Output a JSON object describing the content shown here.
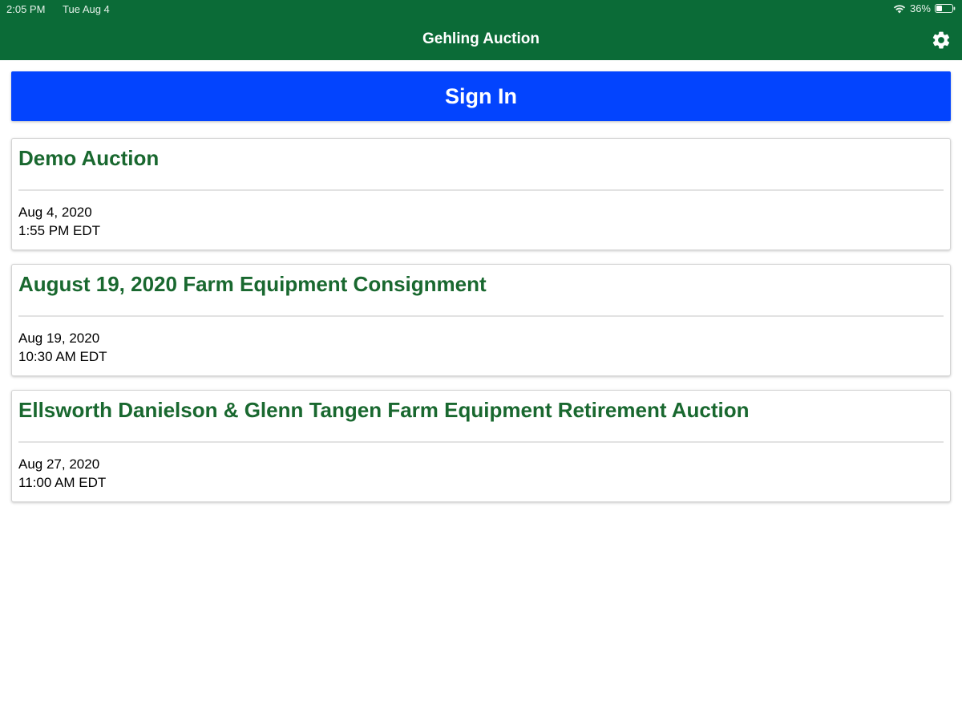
{
  "status_bar": {
    "time": "2:05 PM",
    "date": "Tue Aug 4",
    "battery": "36%"
  },
  "nav": {
    "title": "Gehling Auction",
    "settings_icon": "gear-icon"
  },
  "signin": {
    "label": "Sign In"
  },
  "auctions": [
    {
      "title": "Demo Auction",
      "date": "Aug 4, 2020",
      "time": "1:55 PM EDT"
    },
    {
      "title": "August 19, 2020 Farm Equipment Consignment",
      "date": "Aug 19, 2020",
      "time": "10:30 AM EDT"
    },
    {
      "title": "Ellsworth Danielson & Glenn Tangen Farm Equipment Retirement Auction",
      "date": "Aug 27, 2020",
      "time": "11:00 AM EDT"
    }
  ],
  "colors": {
    "header_green": "#0b6b37",
    "signin_blue": "#0344fe",
    "title_green": "#19682f"
  }
}
